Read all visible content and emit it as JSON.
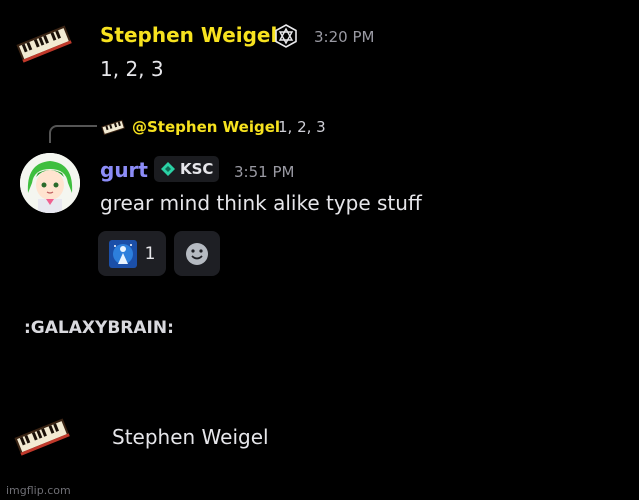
{
  "messages": [
    {
      "author": "Stephen Weigel",
      "time": "3:20 PM",
      "text": "1, 2, 3",
      "author_color": "#f7e21f",
      "avatar_icon": "piano-icon",
      "badge_icon": "hexagon-sigil-icon"
    },
    {
      "reply_to": {
        "author": "@Stephen Weigel",
        "text": "1, 2, 3"
      },
      "author": "gurt",
      "author_color": "#8c8cf7",
      "tag": "KSC",
      "time": "3:51 PM",
      "text": "grear mind think alike type stuff",
      "avatar_icon": "green-hair-avatar",
      "reactions": [
        {
          "emoji": "galaxy-brain-emoji",
          "count": "1"
        },
        {
          "emoji": "add-reaction-icon"
        }
      ]
    }
  ],
  "emoji_caption": ":GALAXYBRAIN:",
  "bottom_user": {
    "name": "Stephen Weigel",
    "avatar_icon": "piano-icon"
  },
  "watermark": "imgflip.com"
}
